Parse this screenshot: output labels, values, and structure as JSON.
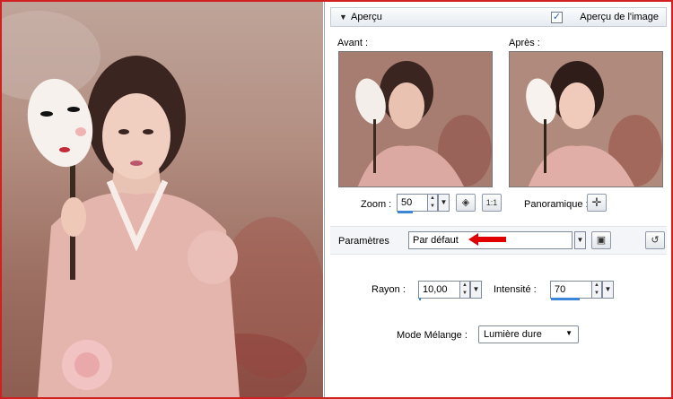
{
  "dialog": {
    "section_title": "Aperçu",
    "preview_checkbox_label": "Aperçu de l'image",
    "preview_checked": true,
    "before_label": "Avant :",
    "after_label": "Après :",
    "zoom_label": "Zoom :",
    "zoom_value": "50",
    "zoom_level": 0.5,
    "pan_label": "Panoramique :",
    "params_label": "Paramètres",
    "preset_value": "Par défaut",
    "radius_label": "Rayon :",
    "radius_value": "10,00",
    "intensity_label": "Intensité :",
    "intensity_value": "70",
    "intensity_level": 0.7,
    "blend_mode_label": "Mode Mélange :",
    "blend_mode_value": "Lumière dure",
    "one_to_one_label": "1:1"
  },
  "colors": {
    "highlight_arrow": "#e00000",
    "frame_border": "#d02020",
    "slider_bar": "#3b86d6"
  },
  "icons": {
    "section_toggle": "triangle-down-icon",
    "fit_zoom": "fit-window-icon",
    "actual_size": "one-to-one-icon",
    "pan": "move-cross-icon",
    "save_preset": "floppy-disk-icon",
    "reset_preset": "reset-icon"
  }
}
